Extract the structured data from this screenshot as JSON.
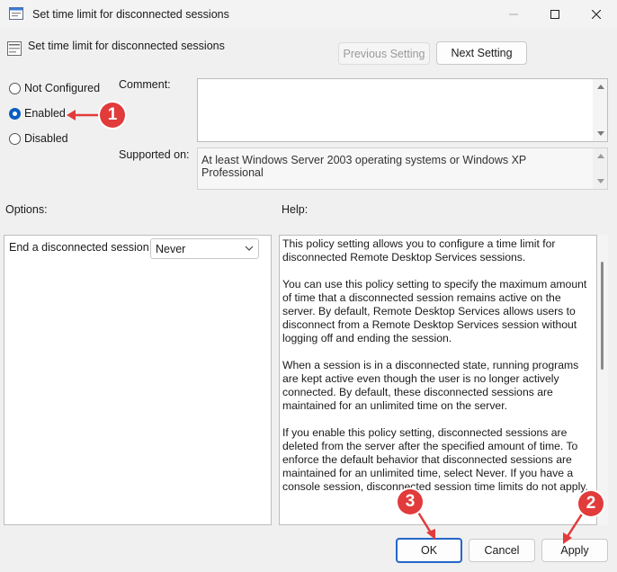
{
  "window": {
    "title": "Set time limit for disconnected sessions",
    "minimize_icon": "minimize-icon",
    "maximize_icon": "maximize-icon",
    "close_icon": "close-icon"
  },
  "header": {
    "policy_title": "Set time limit for disconnected sessions",
    "previous_setting": "Previous Setting",
    "next_setting": "Next Setting"
  },
  "state": {
    "options": [
      {
        "label": "Not Configured",
        "checked": false
      },
      {
        "label": "Enabled",
        "checked": true
      },
      {
        "label": "Disabled",
        "checked": false
      }
    ]
  },
  "comment": {
    "label": "Comment:",
    "value": ""
  },
  "supported": {
    "label": "Supported on:",
    "value": "At least Windows Server 2003 operating systems or Windows XP Professional"
  },
  "options_panel": {
    "label": "Options:",
    "field_label": "End a disconnected session",
    "selected_value": "Never"
  },
  "help": {
    "label": "Help:",
    "paragraphs": [
      "This policy setting allows you to configure a time limit for disconnected Remote Desktop Services sessions.",
      "You can use this policy setting to specify the maximum amount of time that a disconnected session remains active on the server. By default, Remote Desktop Services allows users to disconnect from a Remote Desktop Services session without logging off and ending the session.",
      "When a session is in a disconnected state, running programs are kept active even though the user is no longer actively connected. By default, these disconnected sessions are maintained for an unlimited time on the server.",
      "If you enable this policy setting, disconnected sessions are deleted from the server after the specified amount of time. To enforce the default behavior that disconnected sessions are maintained for an unlimited time, select Never. If you have a console session, disconnected session time limits do not apply."
    ]
  },
  "footer": {
    "ok": "OK",
    "cancel": "Cancel",
    "apply": "Apply"
  },
  "annotations": {
    "callout_1": "1",
    "callout_2": "2",
    "callout_3": "3",
    "accent_color": "#e23b3b"
  }
}
